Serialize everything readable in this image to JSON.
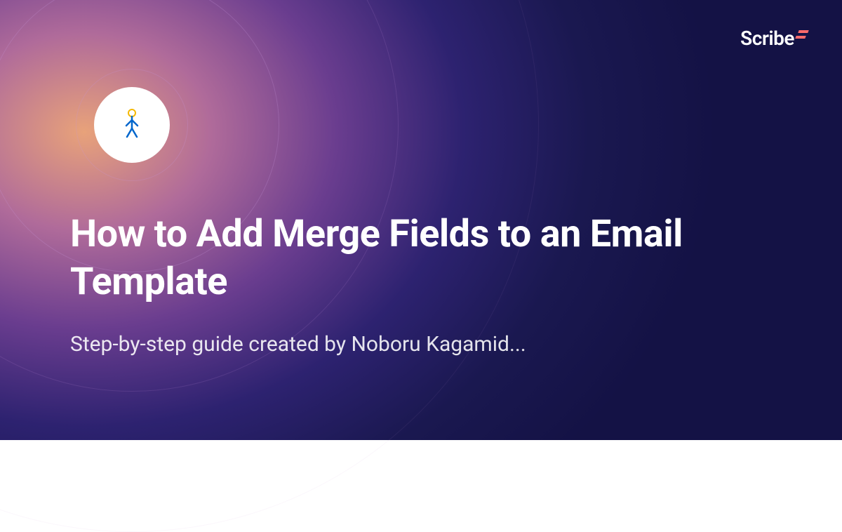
{
  "title": "How to Add Merge Fields to an Email Template",
  "subtitle": "Step-by-step guide created by Noboru Kagamid...",
  "brand": {
    "name": "Scribe"
  }
}
